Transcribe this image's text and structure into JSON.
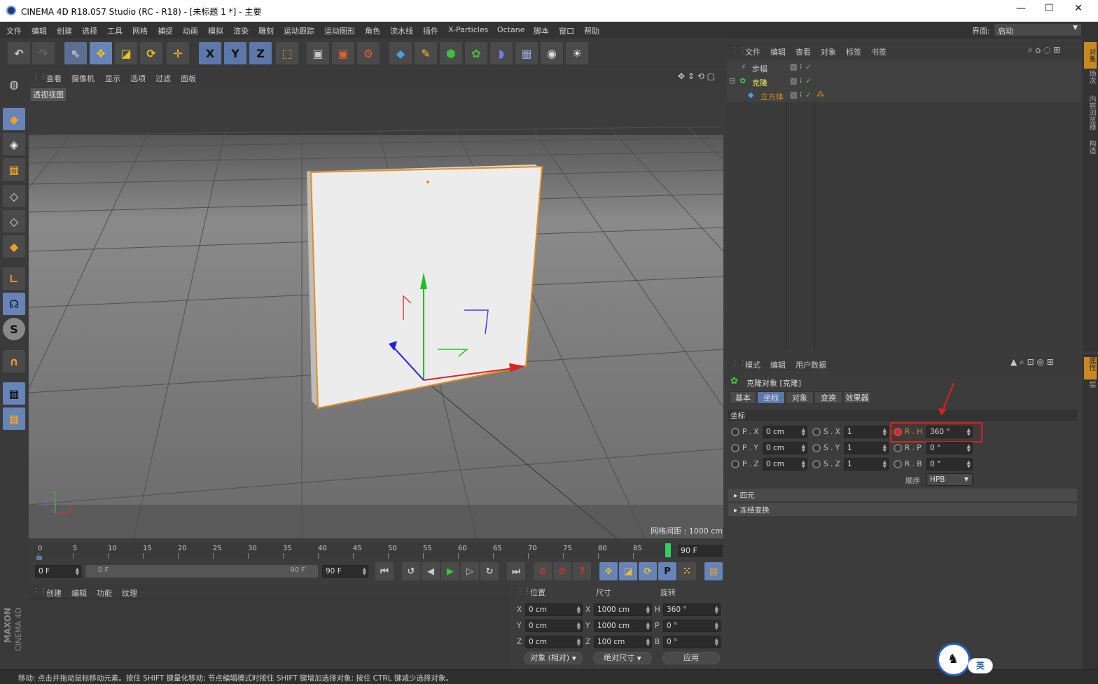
{
  "window": {
    "title": "CINEMA 4D R18.057 Studio (RC - R18) - [未标题 1 *] - 主要",
    "min": "—",
    "max": "☐",
    "close": "✕"
  },
  "menu": [
    "文件",
    "编辑",
    "创建",
    "选择",
    "工具",
    "网格",
    "捕捉",
    "动画",
    "模拟",
    "渲染",
    "雕刻",
    "运动跟踪",
    "运动图形",
    "角色",
    "流水线",
    "插件",
    "X-Particles",
    "Octane",
    "脚本",
    "窗口",
    "帮助"
  ],
  "layout": {
    "label": "界面:",
    "value": "启动"
  },
  "viewport": {
    "menu": [
      "查看",
      "摄像机",
      "显示",
      "选项",
      "过滤",
      "面板"
    ],
    "view_name": "透视视图",
    "grid_info": "网格间距 : 1000 cm",
    "axis": {
      "x": "X",
      "y": "Y",
      "z": "Z"
    }
  },
  "toolbar": {
    "x": "X",
    "y": "Y",
    "z": "Z",
    "s": "S"
  },
  "object_manager": {
    "menu": [
      "文件",
      "编辑",
      "查看",
      "对象",
      "标签",
      "书签"
    ],
    "objects": [
      {
        "name": "步幅",
        "color": "#c8c8c8"
      },
      {
        "name": "克隆",
        "color": "#f0f060"
      },
      {
        "name": "立方体",
        "color": "#e09020"
      }
    ]
  },
  "side_tabs_right": [
    "对象",
    "场次",
    "内容浏览器",
    "构造"
  ],
  "side_tabs_attr": [
    "属性",
    "层"
  ],
  "attributes": {
    "menu": [
      "模式",
      "编辑",
      "用户数据"
    ],
    "object_title": "克隆对象 [克隆]",
    "tabs": [
      "基本",
      "坐标",
      "对象",
      "变换",
      "效果器"
    ],
    "active_tab": "坐标",
    "section": "坐标",
    "px": {
      "label": "P . X",
      "value": "0 cm"
    },
    "py": {
      "label": "P . Y",
      "value": "0 cm"
    },
    "pz": {
      "label": "P . Z",
      "value": "0 cm"
    },
    "sx": {
      "label": "S . X",
      "value": "1"
    },
    "sy": {
      "label": "S . Y",
      "value": "1"
    },
    "sz": {
      "label": "S . Z",
      "value": "1"
    },
    "rh": {
      "label": "R . H",
      "value": "360 °"
    },
    "rp": {
      "label": "R . P",
      "value": "0 °"
    },
    "rb": {
      "label": "R . B",
      "value": "0 °"
    },
    "order_label": "顺序",
    "order_value": "HPB",
    "groups": [
      "四元",
      "冻结变换"
    ]
  },
  "timeline": {
    "ticks": [
      "0",
      "5",
      "10",
      "15",
      "20",
      "25",
      "30",
      "35",
      "40",
      "45",
      "50",
      "55",
      "60",
      "65",
      "70",
      "75",
      "80",
      "85"
    ],
    "current": "90 F",
    "start": "0 F",
    "range_start": "0 F",
    "range_end": "90 F",
    "end": "90 F"
  },
  "material_manager": {
    "menu": [
      "创建",
      "编辑",
      "功能",
      "纹理"
    ]
  },
  "coords": {
    "headers": [
      "位置",
      "尺寸",
      "旋转"
    ],
    "rows": [
      {
        "axis": "X",
        "pos": "0 cm",
        "size_axis": "X",
        "size": "1000 cm",
        "rot_axis": "H",
        "rot": "360 °"
      },
      {
        "axis": "Y",
        "pos": "0 cm",
        "size_axis": "Y",
        "size": "1000 cm",
        "rot_axis": "P",
        "rot": "0 °"
      },
      {
        "axis": "Z",
        "pos": "0 cm",
        "size_axis": "Z",
        "size": "100 cm",
        "rot_axis": "B",
        "rot": "0 °"
      }
    ],
    "mode1": "对象 (相对)",
    "mode2": "绝对尺寸",
    "apply": "应用"
  },
  "brand": {
    "line1": "MAXON",
    "line2": "CINEMA 4D"
  },
  "status": "移动: 点击并拖动鼠标移动元素。按住 SHIFT 键量化移动; 节点编辑模式时按住 SHIFT 键增加选择对象; 按住 CTRL 键减少选择对象。",
  "ime": {
    "label": "英"
  }
}
